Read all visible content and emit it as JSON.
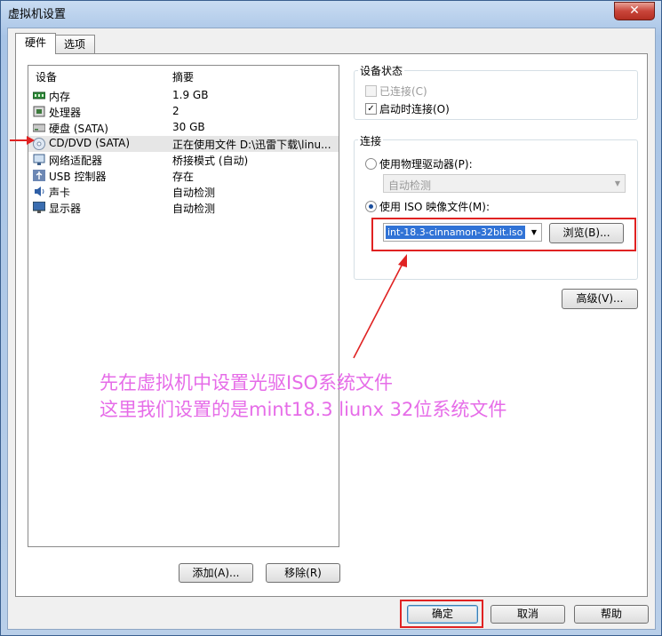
{
  "window": {
    "title": "虚拟机设置",
    "close_symbol": "✕"
  },
  "tabs": [
    {
      "label": "硬件"
    },
    {
      "label": "选项"
    }
  ],
  "device_list": {
    "headers": {
      "device": "设备",
      "summary": "摘要"
    },
    "rows": [
      {
        "name": "内存",
        "summary": "1.9 GB",
        "icon": "memory-icon"
      },
      {
        "name": "处理器",
        "summary": "2",
        "icon": "processor-icon"
      },
      {
        "name": "硬盘 (SATA)",
        "summary": "30 GB",
        "icon": "hard-disk-icon"
      },
      {
        "name": "CD/DVD (SATA)",
        "summary": "正在使用文件 D:\\迅雷下载\\linu...",
        "icon": "cd-dvd-icon"
      },
      {
        "name": "网络适配器",
        "summary": "桥接模式 (自动)",
        "icon": "network-adapter-icon"
      },
      {
        "name": "USB 控制器",
        "summary": "存在",
        "icon": "usb-icon"
      },
      {
        "name": "声卡",
        "summary": "自动检测",
        "icon": "sound-card-icon"
      },
      {
        "name": "显示器",
        "summary": "自动检测",
        "icon": "monitor-icon"
      }
    ],
    "selected_index": 3
  },
  "list_buttons": {
    "add": "添加(A)...",
    "remove": "移除(R)"
  },
  "device_status": {
    "title": "设备状态",
    "connected": {
      "label": "已连接(C)",
      "checked": false,
      "enabled": false
    },
    "connect_on_start": {
      "label": "启动时连接(O)",
      "checked": true
    }
  },
  "connection": {
    "title": "连接",
    "physical_drive": {
      "label": "使用物理驱动器(P):",
      "selected": false,
      "value": "自动检测"
    },
    "iso_image": {
      "label": "使用 ISO 映像文件(M):",
      "selected": true,
      "value": "int-18.3-cinnamon-32bit.iso"
    },
    "browse": "浏览(B)...",
    "advanced": "高级(V)..."
  },
  "annotation": {
    "line1": "先在虚拟机中设置光驱ISO系统文件",
    "line2": "这里我们设置的是mint18.3  liunx 32位系统文件",
    "color": "#e66ce8",
    "marker_color": "#e02222"
  },
  "footer_buttons": {
    "ok": "确定",
    "cancel": "取消",
    "help": "帮助"
  }
}
